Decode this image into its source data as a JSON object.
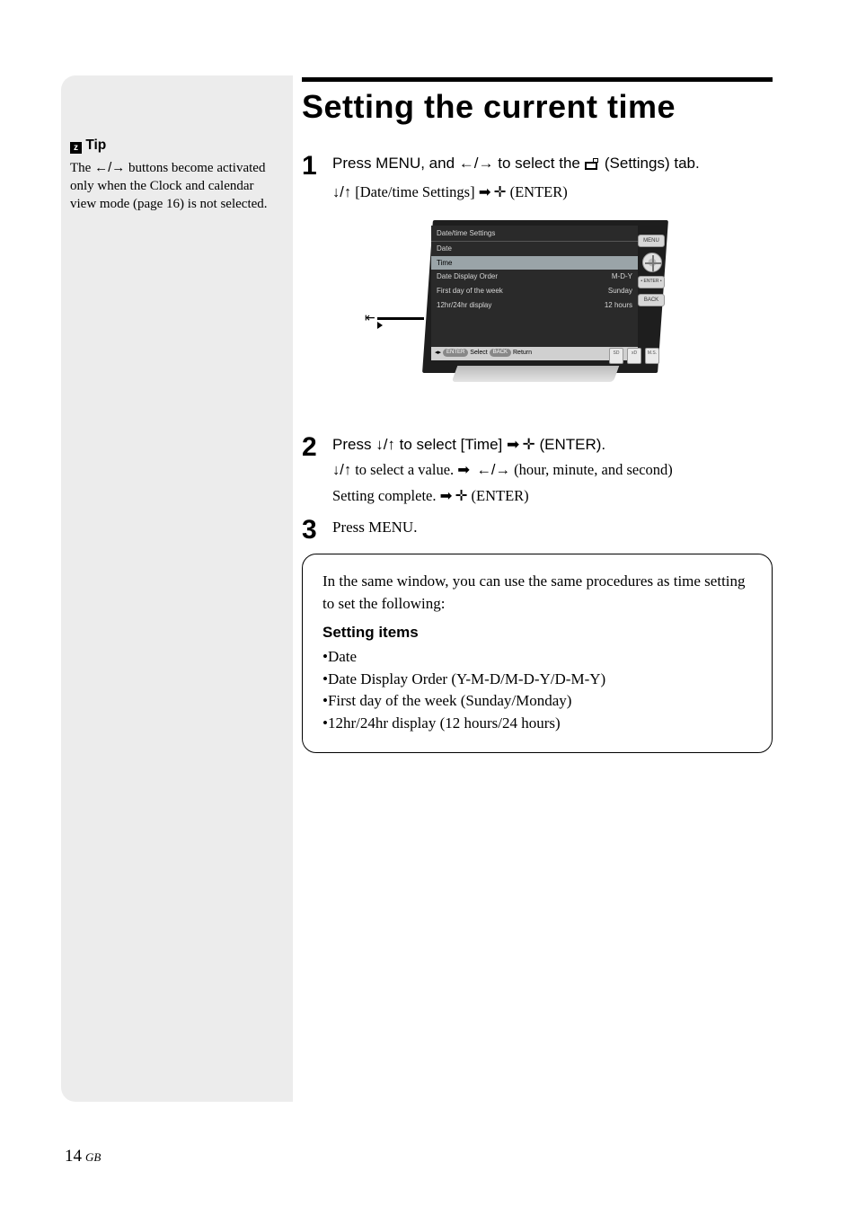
{
  "page": {
    "title": "Setting the current time",
    "number": "14",
    "region": "GB"
  },
  "tip": {
    "label": "Tip",
    "body_pre": "The ",
    "body_arrows": "←/→",
    "body_post": " buttons become activated only when the Clock and calendar view mode (page 16) is not selected."
  },
  "steps": {
    "s1": {
      "num": "1",
      "line_a_pre": "Press MENU, and ",
      "line_a_arrows": "←/→",
      "line_a_mid": " to select the ",
      "line_a_post": " (Settings) tab.",
      "sub_arrows": "↓/↑",
      "sub_item": "  [Date/time Settings] ",
      "sub_enter": " (ENTER)"
    },
    "s2": {
      "num": "2",
      "line_pre": "Press ",
      "line_arrows": "↓/↑",
      "line_mid": " to select [Time] ",
      "line_enter": " (ENTER).",
      "sub1_arrows": "↓/↑",
      "sub1_mid": " to select a value. ",
      "sub1_lr": "←/→",
      "sub1_post": " (hour, minute, and second)",
      "sub2_pre": "Setting complete. ",
      "sub2_enter": " (ENTER)"
    },
    "s3": {
      "num": "3",
      "line": "Press MENU."
    }
  },
  "device_screen": {
    "header": "Date/time Settings",
    "rows": [
      {
        "label": "Date",
        "value": ""
      },
      {
        "label": "Time",
        "value": ""
      },
      {
        "label": "Date Display Order",
        "value": "M-D-Y"
      },
      {
        "label": "First day of the week",
        "value": "Sunday"
      },
      {
        "label": "12hr/24hr display",
        "value": "12 hours"
      }
    ],
    "status_select": "Select",
    "status_return": "Return",
    "status_enter": "ENTER",
    "status_back": "BACK",
    "btn_menu": "MENU",
    "btn_back": "BACK",
    "btn_enter": "• ENTER •",
    "slot_sd": "SD",
    "slot_xd": "xD",
    "slot_ms": "M.S."
  },
  "info": {
    "intro": "In the same window, you can use the same procedures as time setting to set the following:",
    "heading": "Setting items",
    "items": [
      "Date",
      "Date Display Order (Y-M-D/M-D-Y/D-M-Y)",
      "First day of the week (Sunday/Monday)",
      "12hr/24hr display (12 hours/24 hours)"
    ]
  },
  "glyphs": {
    "thick_arrow": "➡",
    "enter": "✛"
  }
}
